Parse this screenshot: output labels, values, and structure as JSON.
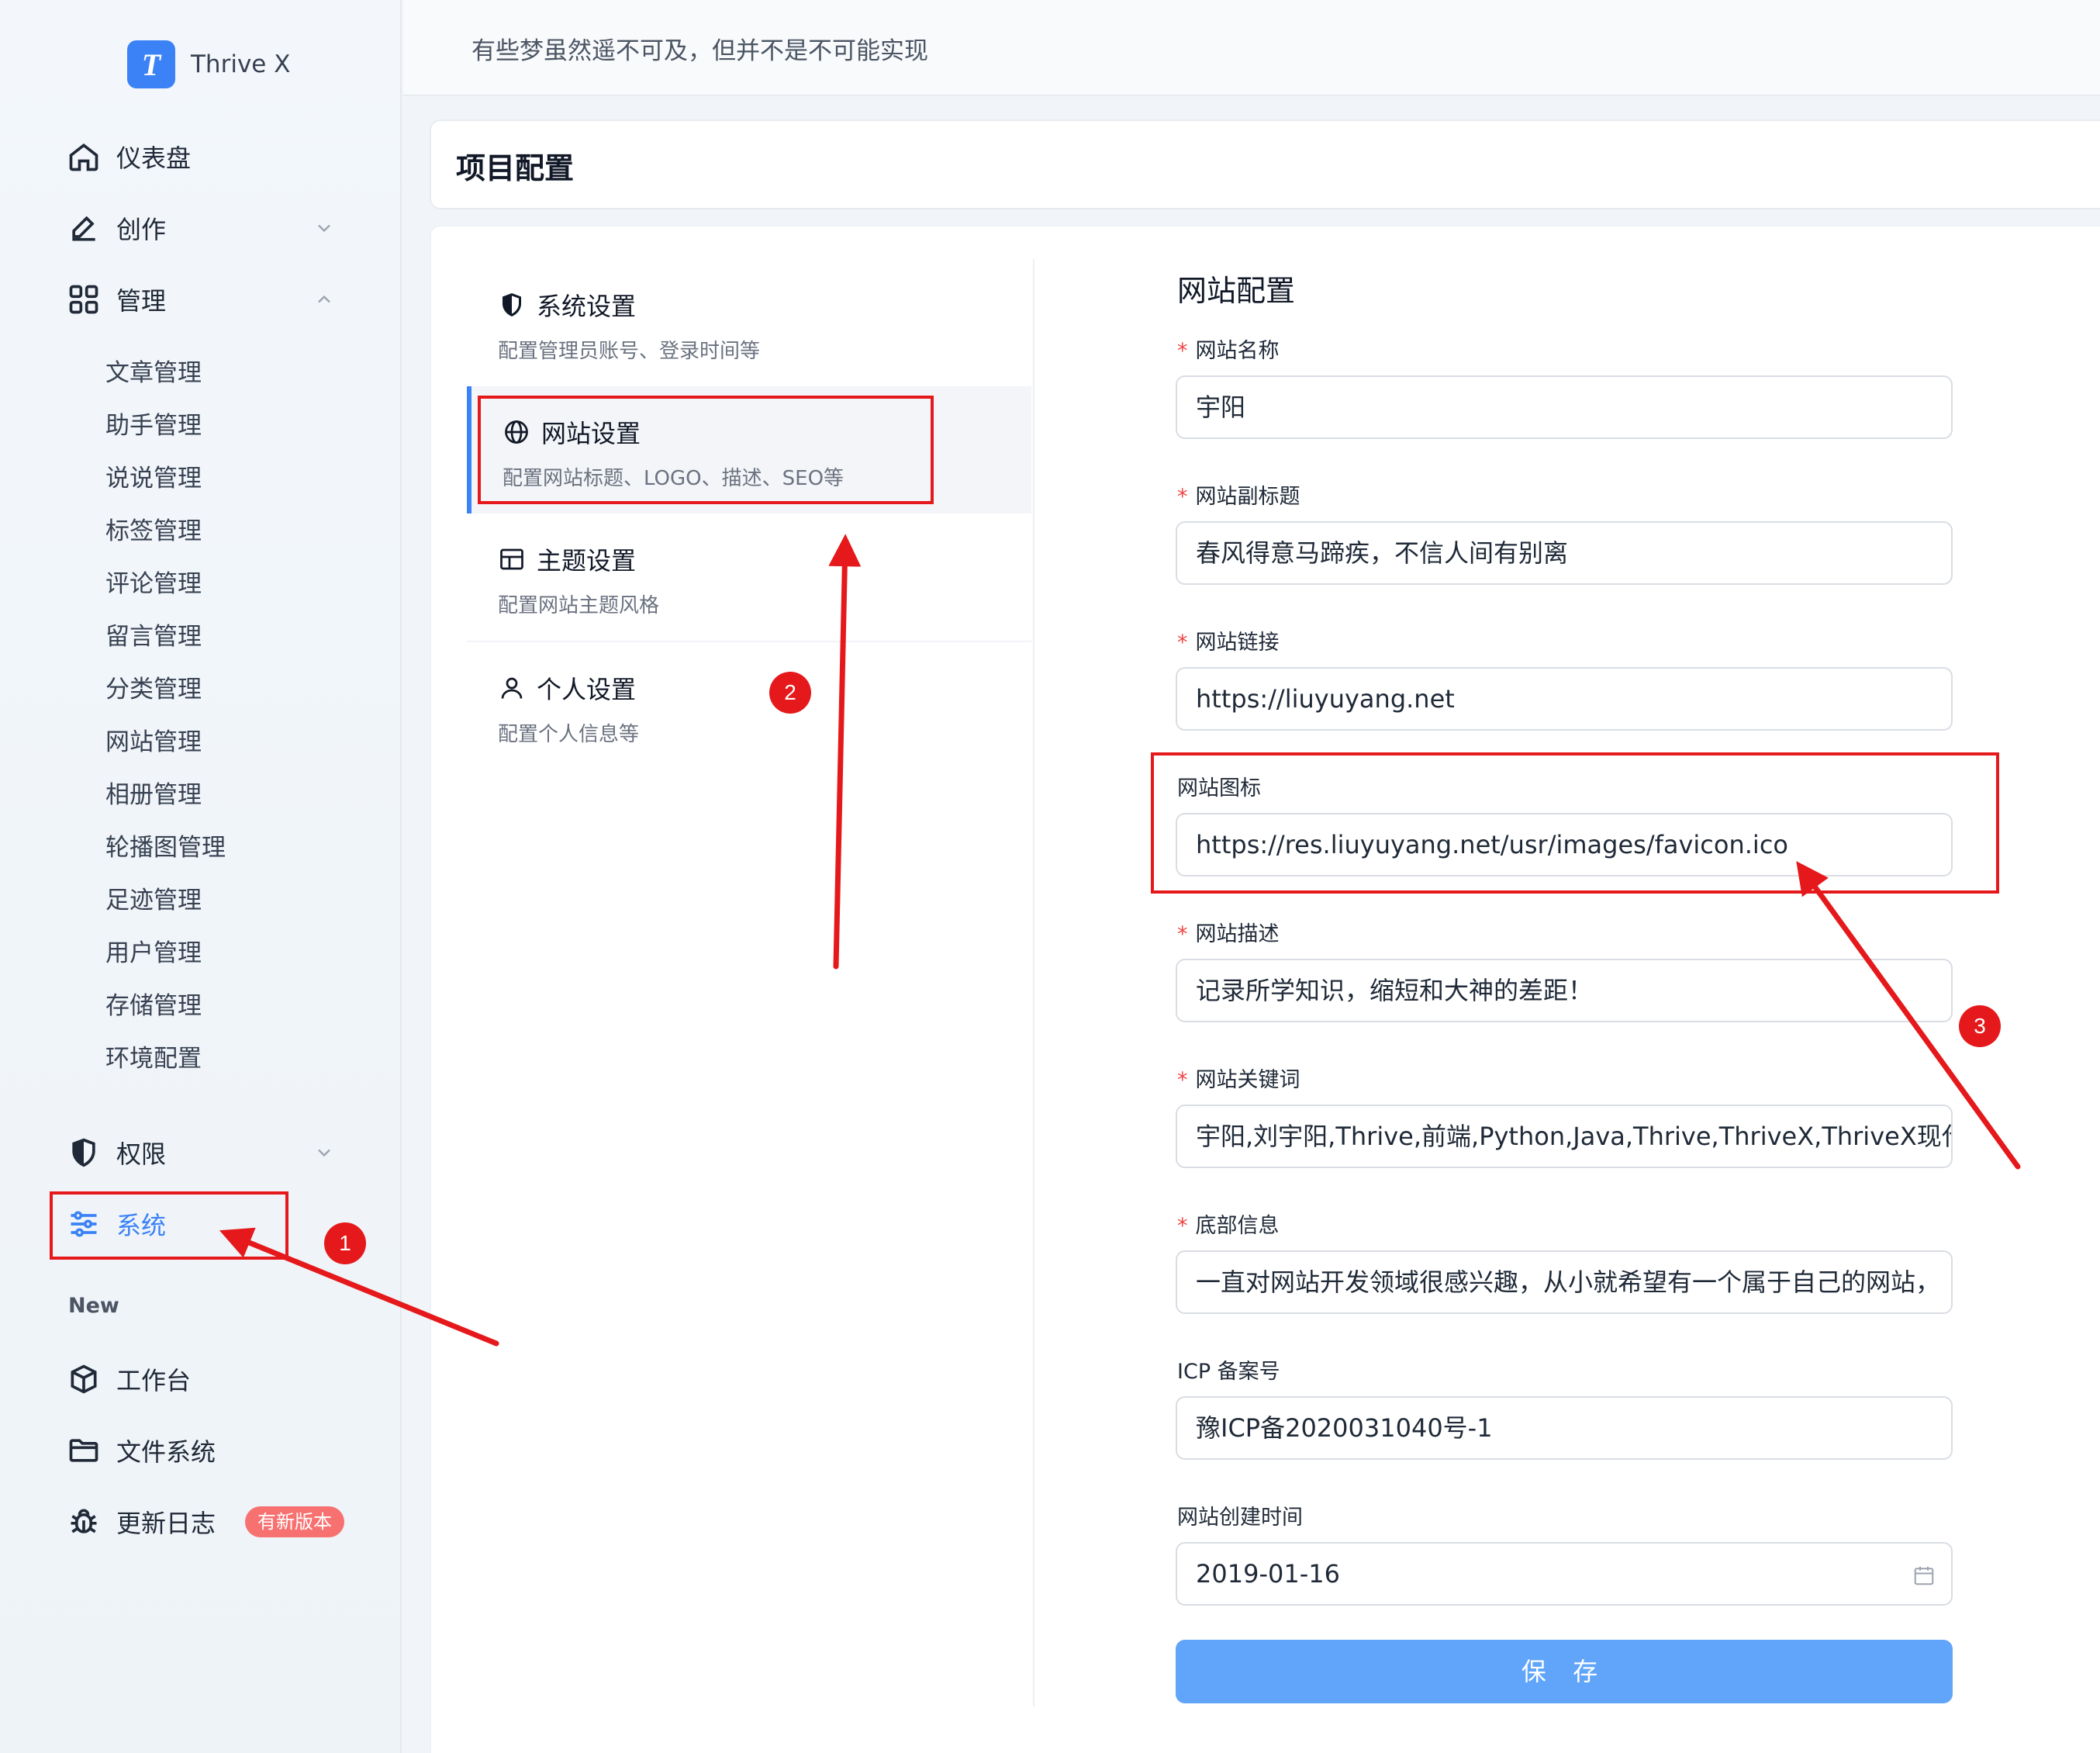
{
  "brand": {
    "name": "Thrive X",
    "logo_letter": "T"
  },
  "header": {
    "slogan": "有些梦虽然遥不可及，但并不是不可能实现"
  },
  "page": {
    "title": "项目配置"
  },
  "sidebar": {
    "dashboard": "仪表盘",
    "create": "创作",
    "manage": "管理",
    "manage_items": [
      "文章管理",
      "助手管理",
      "说说管理",
      "标签管理",
      "评论管理",
      "留言管理",
      "分类管理",
      "网站管理",
      "相册管理",
      "轮播图管理",
      "足迹管理",
      "用户管理",
      "存储管理",
      "环境配置"
    ],
    "permission": "权限",
    "system": "系统",
    "group_new": "New",
    "workbench": "工作台",
    "filesystem": "文件系统",
    "changelog": "更新日志",
    "changelog_badge": "有新版本"
  },
  "settings_menu": [
    {
      "title": "系统设置",
      "desc": "配置管理员账号、登录时间等",
      "icon": "shield-icon"
    },
    {
      "title": "网站设置",
      "desc": "配置网站标题、LOGO、描述、SEO等",
      "icon": "globe-icon"
    },
    {
      "title": "主题设置",
      "desc": "配置网站主题风格",
      "icon": "layout-icon"
    },
    {
      "title": "个人设置",
      "desc": "配置个人信息等",
      "icon": "user-icon"
    }
  ],
  "form": {
    "title": "网站配置",
    "fields": [
      {
        "label": "网站名称",
        "value": "宇阳",
        "required": true
      },
      {
        "label": "网站副标题",
        "value": "春风得意马蹄疾，不信人间有别离",
        "required": true
      },
      {
        "label": "网站链接",
        "value": "https://liuyuyang.net",
        "required": true
      },
      {
        "label": "网站图标",
        "value": "https://res.liuyuyang.net/usr/images/favicon.ico",
        "required": false
      },
      {
        "label": "网站描述",
        "value": "记录所学知识，缩短和大神的差距！",
        "required": true
      },
      {
        "label": "网站关键词",
        "value": "宇阳,刘宇阳,Thrive,前端,Python,Java,Thrive,ThriveX,ThriveX现代化",
        "required": true
      },
      {
        "label": "底部信息",
        "value": "一直对网站开发领域很感兴趣，从小就希望有一个属于自己的网站，",
        "required": true
      },
      {
        "label": "ICP 备案号",
        "value": "豫ICP备2020031040号-1",
        "required": false
      },
      {
        "label": "网站创建时间",
        "value": "2019-01-16",
        "required": false
      }
    ],
    "save_label": "保 存"
  },
  "annotations": {
    "n1": "1",
    "n2": "2",
    "n3": "3"
  },
  "colors": {
    "accent": "#3b82f6",
    "annotation": "#e5191b",
    "required": "#ef4444",
    "save_button": "#60a5fa"
  }
}
